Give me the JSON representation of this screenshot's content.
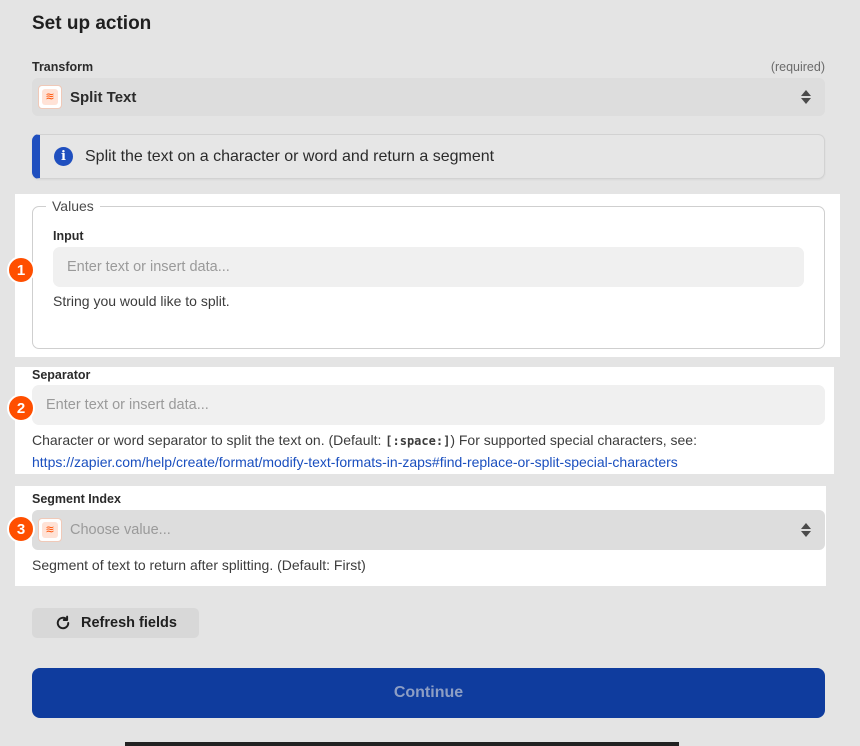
{
  "header": {
    "title": "Set up action"
  },
  "transform": {
    "label": "Transform",
    "required_text": "(required)",
    "selected": "Split Text",
    "icon": "formatter-icon"
  },
  "info_banner": {
    "text": "Split the text on a character or word and return a segment"
  },
  "values_group": {
    "legend": "Values",
    "input": {
      "label": "Input",
      "placeholder": "Enter text or insert data...",
      "help": "String you would like to split.",
      "badge": "1"
    }
  },
  "separator": {
    "label": "Separator",
    "placeholder": "Enter text or insert data...",
    "help_before": "Character or word separator to split the text on. (Default:",
    "help_code": "[:space:]",
    "help_after": ") For supported special characters, see:",
    "help_link": "https://zapier.com/help/create/format/modify-text-formats-in-zaps#find-replace-or-split-special-characters",
    "badge": "2"
  },
  "segment_index": {
    "label": "Segment Index",
    "placeholder": "Choose value...",
    "help": "Segment of text to return after splitting. (Default: First)",
    "badge": "3"
  },
  "actions": {
    "refresh_label": "Refresh fields",
    "continue_label": "Continue"
  },
  "colors": {
    "accent_blue": "#1f4fbf",
    "continue_blue": "#0f3c9e",
    "badge_orange": "#ff4f00"
  }
}
